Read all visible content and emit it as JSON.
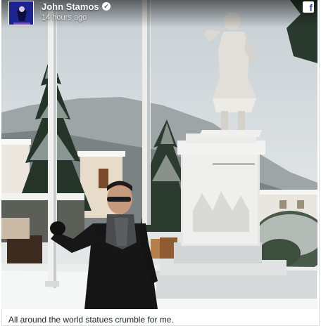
{
  "post": {
    "author": "John Stamos",
    "timestamp": "14 hours ago",
    "caption": "All around the world statues crumble for me."
  },
  "icons": {
    "verified": "verified-badge-icon",
    "platform": "facebook-icon"
  },
  "colors": {
    "facebook_blue": "#3b5998",
    "caption_text": "#1d2129"
  }
}
